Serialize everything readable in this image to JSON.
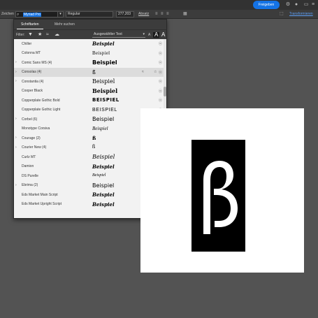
{
  "appbar": {
    "share_label": "Freigeben"
  },
  "control_bar": {
    "char_label": "Zeichen",
    "font_value": "Myriad Pro",
    "style_value": "Regular",
    "size_value": "277,203",
    "align_label": "Absatz",
    "transform_label": "Transformieren"
  },
  "panel": {
    "tabs": [
      {
        "label": "Schriftarten",
        "active": true
      },
      {
        "label": "Mehr suchen",
        "active": false
      }
    ],
    "filter_label": "Filter:",
    "sample_select": "Ausgewählter Text",
    "size_small": "A",
    "size_medium": "A",
    "size_large": "A"
  },
  "font_list": [
    {
      "name": "Chiller",
      "sample": "Beispiel",
      "expand": false,
      "icon": "ⓞ"
    },
    {
      "name": "Colonna MT",
      "sample": "Beispiel",
      "expand": false,
      "icon": "ⓞ"
    },
    {
      "name": "Comic Sans MS (4)",
      "sample": "Beispiel",
      "expand": true,
      "icon": "ⓞ"
    },
    {
      "name": "Consolas (4)",
      "sample": "ß",
      "expand": true,
      "icon": "ⓞ",
      "highlight": true
    },
    {
      "name": "Constantia (4)",
      "sample": "Beispiel",
      "expand": true,
      "icon": "ⓞ"
    },
    {
      "name": "Cooper Black",
      "sample": "Beispiel",
      "expand": false,
      "icon": "ⓞ"
    },
    {
      "name": "Copperplate Gothic Bold",
      "sample": "BEISPIEL",
      "expand": false,
      "icon": "ⓞ"
    },
    {
      "name": "Copperplate Gothic Light",
      "sample": "BEISPIEL",
      "expand": false,
      "icon": "ⓞ"
    },
    {
      "name": "Corbel (6)",
      "sample": "Beispiel",
      "expand": true,
      "icon": "ⓞ"
    },
    {
      "name": "Monotype Corsiva",
      "sample": "Beispiel",
      "expand": false,
      "icon": "ⓞ"
    },
    {
      "name": "Courage (2)",
      "sample": "ß",
      "expand": true,
      "icon": "☁"
    },
    {
      "name": "Courier New (4)",
      "sample": "ß",
      "expand": true,
      "icon": "ⓞ"
    },
    {
      "name": "Curlz MT",
      "sample": "Beispiel",
      "expand": false,
      "icon": "ⓞ"
    },
    {
      "name": "Damion",
      "sample": "Beispiel",
      "expand": false,
      "icon": "Tk"
    },
    {
      "name": "DS Purelle",
      "sample": "Beispiel",
      "expand": false,
      "icon": "☁"
    },
    {
      "name": "Ebrima (2)",
      "sample": "Beispiel",
      "expand": true,
      "icon": "ⓞ"
    },
    {
      "name": "Eds Market Main Script",
      "sample": "Beispiel",
      "expand": false,
      "icon": "☁"
    },
    {
      "name": "Eds Market Upright Script",
      "sample": "Beispiel",
      "expand": false,
      "icon": "☁"
    }
  ],
  "artboard": {
    "glyph": "ß"
  }
}
